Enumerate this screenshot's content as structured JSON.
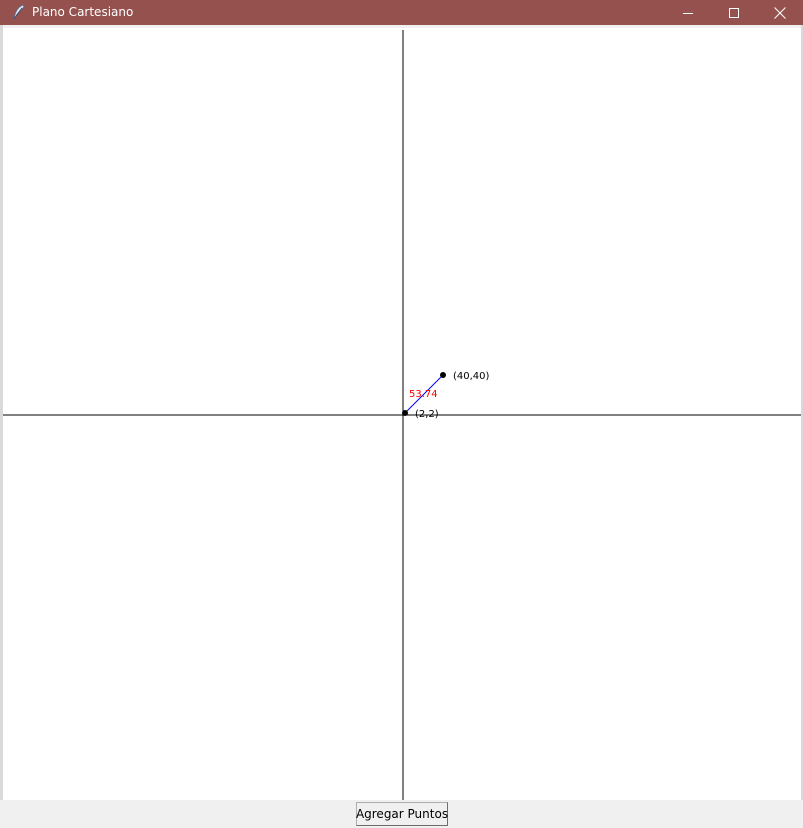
{
  "window": {
    "title": "Plano Cartesiano",
    "app_icon": "feather-icon",
    "controls": {
      "minimize_icon": "minimize-icon",
      "maximize_icon": "maximize-icon",
      "close_icon": "close-icon"
    },
    "titlebar_color": "#94514d"
  },
  "plane": {
    "background": "#ffffff",
    "axis_color": "#000000",
    "points": [
      {
        "label": "(2,2)",
        "x": 2,
        "y": 2
      },
      {
        "label": "(40,40)",
        "x": 40,
        "y": 40
      }
    ],
    "segment": {
      "color": "#0000ff",
      "distance_label": "53.74",
      "distance_color": "#ff0000"
    }
  },
  "footer": {
    "add_points_label": "Agregar Puntos"
  }
}
